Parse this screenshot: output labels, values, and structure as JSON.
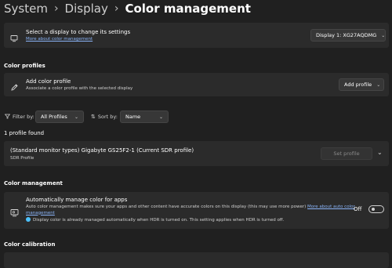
{
  "breadcrumb": {
    "item1": "System",
    "item2": "Display",
    "current": "Color management",
    "separator": "›"
  },
  "display_select": {
    "title": "Select a display to change its settings",
    "link": "More about color management",
    "selected": "Display 1: XG27AQDMG"
  },
  "color_profiles": {
    "section_title": "Color profiles",
    "add_title": "Add color profile",
    "add_desc": "Associate a color profile with the selected display",
    "add_button": "Add profile"
  },
  "filters": {
    "filter_label": "Filter by:",
    "filter_value": "All Profiles",
    "sort_label": "Sort by:",
    "sort_value": "Name"
  },
  "profiles": {
    "count_text": "1 profile found",
    "items": [
      {
        "name": "(Standard monitor types) Gigabyte GS25F2-1 (Current SDR profile)",
        "type": "SDR Profile",
        "button": "Set profile"
      }
    ]
  },
  "color_management": {
    "section_title": "Color management",
    "auto_title": "Automatically manage color for apps",
    "auto_desc": "Auto color management makes sure your apps and other content have accurate colors on this display (this may use more power)",
    "auto_link": "More about auto color management",
    "auto_info": "Display color is already managed automatically when HDR is turned on. This setting applies when HDR is turned off.",
    "toggle_label": "Off"
  },
  "color_calibration": {
    "section_title": "Color calibration"
  },
  "icons": {
    "display": "monitor-icon",
    "add": "pen-icon",
    "auto_color": "screen-color-icon",
    "filter": "filter-icon",
    "sort": "sort-icon",
    "info": "info-icon",
    "chevron": "chevron-down-icon"
  },
  "colors": {
    "background": "#202020",
    "card": "#2b2b2b",
    "link": "#8ab4f8",
    "accent": "#4cc2ff"
  }
}
